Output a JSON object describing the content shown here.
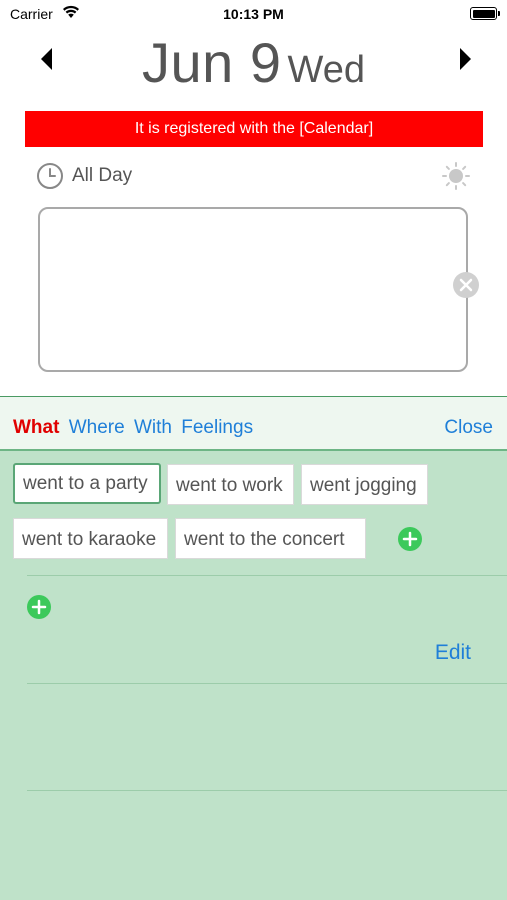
{
  "status_bar": {
    "carrier": "Carrier",
    "time": "10:13 PM"
  },
  "date_header": {
    "date": "Jun 9",
    "weekday": "Wed",
    "prev_icon": "triangle-left-icon",
    "next_icon": "triangle-right-icon"
  },
  "banner": {
    "text": "It is registered with the [Calendar]",
    "color": "#ff0000"
  },
  "event": {
    "all_day_label": "All Day",
    "clock_icon": "clock-icon",
    "weather_icon": "sun-icon",
    "note_text": "",
    "clear_icon": "clear-x-icon"
  },
  "panel": {
    "tabs": [
      {
        "label": "What",
        "active": true
      },
      {
        "label": "Where",
        "active": false
      },
      {
        "label": "With",
        "active": false
      },
      {
        "label": "Feelings",
        "active": false
      }
    ],
    "close_label": "Close",
    "keywords": [
      {
        "label": "went to a party",
        "selected": true
      },
      {
        "label": "went to work",
        "selected": false
      },
      {
        "label": "went jogging",
        "selected": false
      },
      {
        "label": "went to karaoke",
        "selected": false
      },
      {
        "label": "went to the concert",
        "selected": false
      }
    ],
    "add_icon": "plus-circle-icon",
    "edit_label": "Edit",
    "colors": {
      "panel_bg": "#bfe2c9",
      "active_tab": "#e00000",
      "link": "#1f7fd8",
      "add_green": "#3cc95b"
    }
  }
}
